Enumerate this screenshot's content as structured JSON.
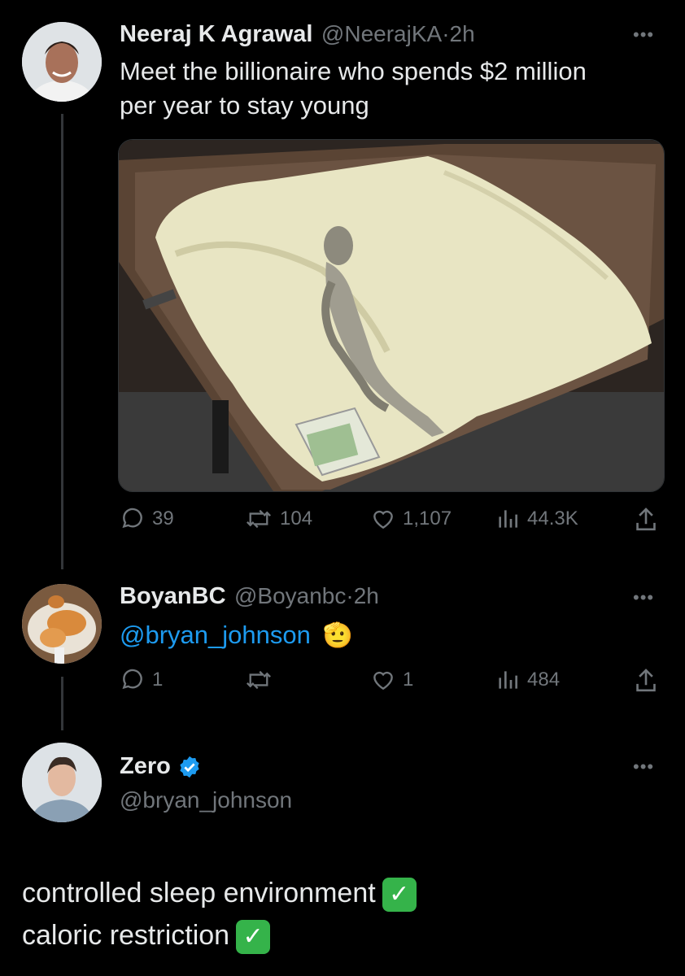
{
  "tweet1": {
    "name": "Neeraj K Agrawal",
    "handle": "@NeerajKA",
    "separator": "·",
    "time": "2h",
    "text_line1": "Meet the billionaire who spends $2 million",
    "text_line2": "per year to stay young",
    "more_icon": "ellipsis-icon",
    "actions": {
      "replies": "39",
      "retweets": "104",
      "likes": "1,107",
      "views": "44.3K"
    }
  },
  "tweet2": {
    "name": "BoyanBC",
    "handle": "@Boyanbc",
    "separator": "·",
    "time": "2h",
    "mention": "@bryan_johnson",
    "emoji": "🫡",
    "actions": {
      "replies": "1",
      "retweets": "",
      "likes": "1",
      "views": "484"
    }
  },
  "tweet3": {
    "name": "Zero",
    "handle": "@bryan_johnson",
    "verified_icon": "verified-badge-icon",
    "line1": "controlled sleep environment",
    "line2": "caloric restriction",
    "check_glyph": "✓"
  },
  "colors": {
    "background": "#000000",
    "text": "#e7e9ea",
    "muted": "#71767b",
    "link": "#1d9bf0",
    "check_green": "#35b34a"
  }
}
